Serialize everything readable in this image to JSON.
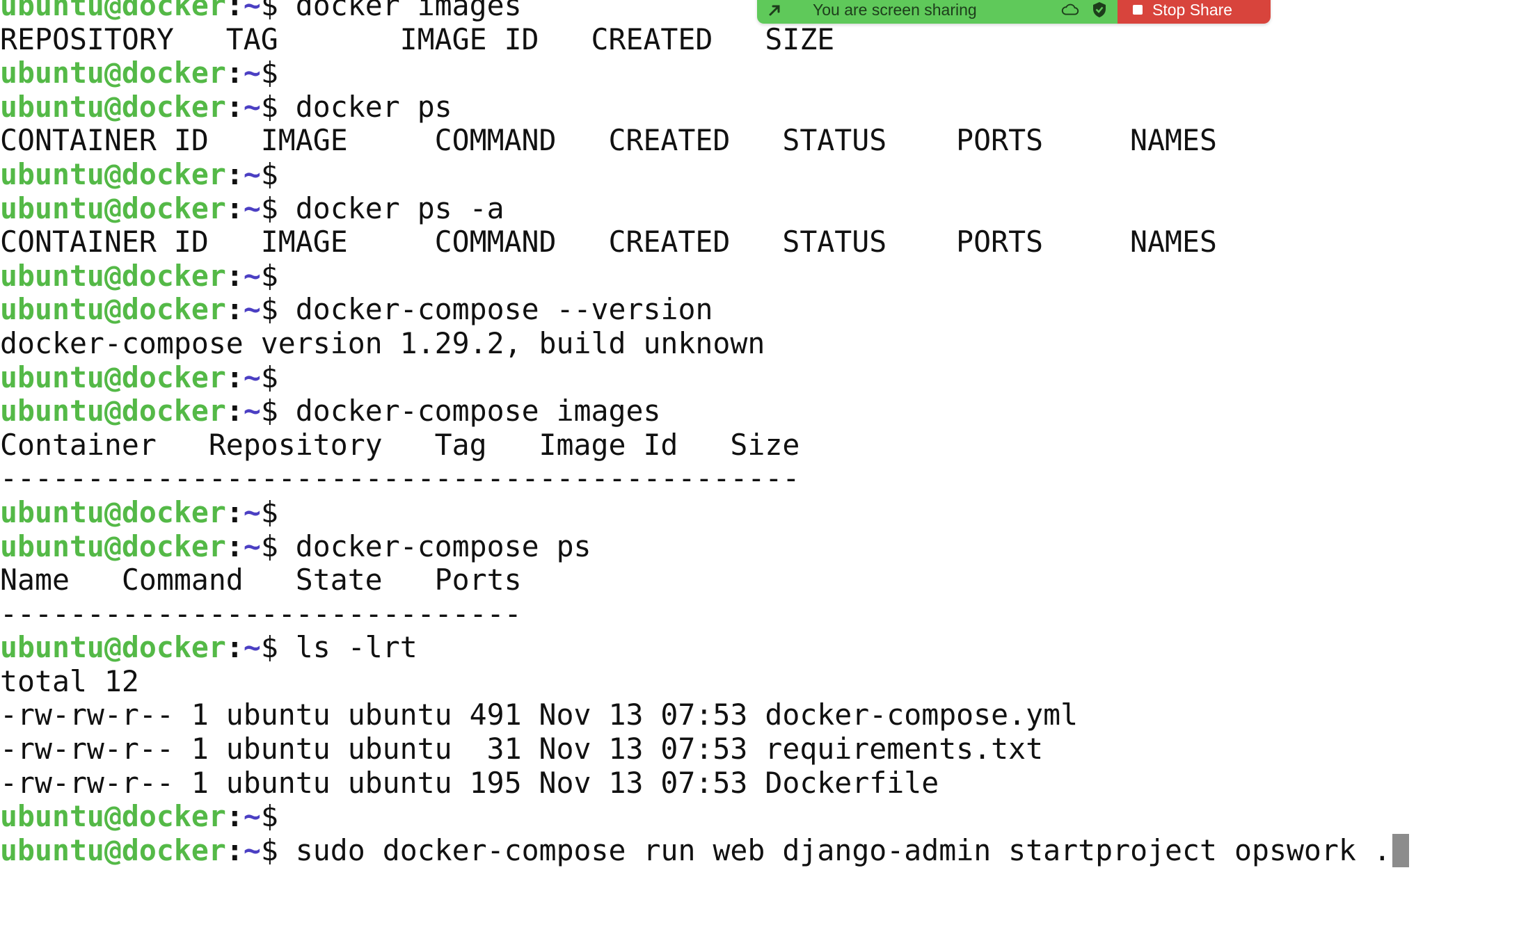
{
  "share_bar": {
    "status_text": "You are screen sharing",
    "stop_label": "Stop Share"
  },
  "prompt": {
    "user_host": "ubuntu@docker",
    "colon": ":",
    "path": "~",
    "dollar": "$"
  },
  "lines": [
    {
      "kind": "prompt",
      "cmd": " docker images"
    },
    {
      "kind": "output",
      "text": "REPOSITORY   TAG       IMAGE ID   CREATED   SIZE"
    },
    {
      "kind": "prompt",
      "cmd": ""
    },
    {
      "kind": "prompt",
      "cmd": " docker ps"
    },
    {
      "kind": "output",
      "text": "CONTAINER ID   IMAGE     COMMAND   CREATED   STATUS    PORTS     NAMES"
    },
    {
      "kind": "prompt",
      "cmd": ""
    },
    {
      "kind": "prompt",
      "cmd": " docker ps -a"
    },
    {
      "kind": "output",
      "text": "CONTAINER ID   IMAGE     COMMAND   CREATED   STATUS    PORTS     NAMES"
    },
    {
      "kind": "prompt",
      "cmd": ""
    },
    {
      "kind": "prompt",
      "cmd": " docker-compose --version"
    },
    {
      "kind": "output",
      "text": "docker-compose version 1.29.2, build unknown"
    },
    {
      "kind": "prompt",
      "cmd": ""
    },
    {
      "kind": "prompt",
      "cmd": " docker-compose images"
    },
    {
      "kind": "output",
      "text": "Container   Repository   Tag   Image Id   Size"
    },
    {
      "kind": "output",
      "text": "----------------------------------------------"
    },
    {
      "kind": "prompt",
      "cmd": ""
    },
    {
      "kind": "prompt",
      "cmd": " docker-compose ps"
    },
    {
      "kind": "output",
      "text": "Name   Command   State   Ports"
    },
    {
      "kind": "output",
      "text": "------------------------------"
    },
    {
      "kind": "prompt",
      "cmd": " ls -lrt"
    },
    {
      "kind": "output",
      "text": "total 12"
    },
    {
      "kind": "output",
      "text": "-rw-rw-r-- 1 ubuntu ubuntu 491 Nov 13 07:53 docker-compose.yml"
    },
    {
      "kind": "output",
      "text": "-rw-rw-r-- 1 ubuntu ubuntu  31 Nov 13 07:53 requirements.txt"
    },
    {
      "kind": "output",
      "text": "-rw-rw-r-- 1 ubuntu ubuntu 195 Nov 13 07:53 Dockerfile"
    },
    {
      "kind": "prompt",
      "cmd": ""
    },
    {
      "kind": "prompt",
      "cmd": " sudo docker-compose run web django-admin startproject opswork .",
      "cursor": true
    }
  ],
  "colors": {
    "user_host": "#54b947",
    "path": "#4b3fc3",
    "share_green": "#5fc95a",
    "share_red": "#d8443c",
    "cursor": "#8c8c8c"
  },
  "icons": {
    "share_left": "phone-arrow-icon",
    "share_cloud": "cloud-icon",
    "share_shield": "shield-check-icon",
    "stop": "stop-square-icon"
  }
}
